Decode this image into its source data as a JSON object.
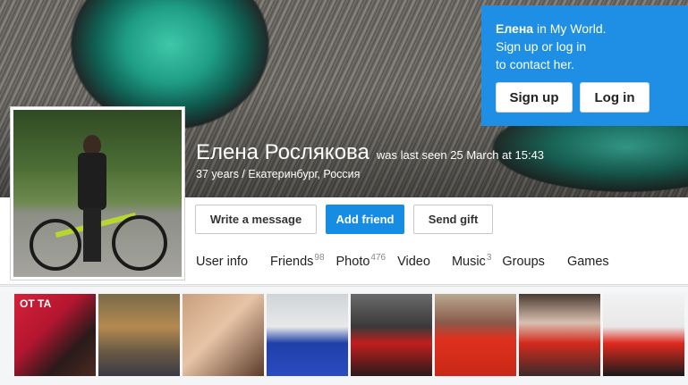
{
  "cover": {
    "image": "cat-eye-cover"
  },
  "promo": {
    "name": "Елена",
    "text_suffix": " in My World.",
    "line2": "Sign up or log in",
    "line3": "to contact her.",
    "signup_label": "Sign up",
    "login_label": "Log in"
  },
  "profile": {
    "name": "Елена Рослякова",
    "last_seen": "was last seen 25 March at 15:43",
    "subinfo": "37 years / Екатеринбург, Россия"
  },
  "actions": {
    "write_message": "Write a message",
    "add_friend": "Add friend",
    "send_gift": "Send gift"
  },
  "tabs": [
    {
      "label": "User info",
      "count": ""
    },
    {
      "label": "Friends",
      "count": "98"
    },
    {
      "label": "Photo",
      "count": "476"
    },
    {
      "label": "Video",
      "count": ""
    },
    {
      "label": "Music",
      "count": "3"
    },
    {
      "label": "Groups",
      "count": ""
    },
    {
      "label": "Games",
      "count": ""
    }
  ],
  "photos": {
    "thumb1_text": "ОТ      ТА"
  },
  "colors": {
    "accent": "#1f8fe5",
    "button_blue": "#168de2"
  }
}
